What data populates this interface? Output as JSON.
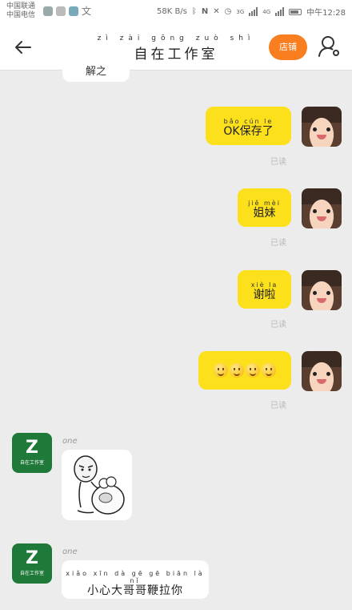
{
  "status_bar": {
    "carrier_line1": "中国联通",
    "carrier_line2": "中国电信",
    "net_speed": "58K B/s",
    "signal_3g": "3G",
    "signal_4g": "4G",
    "time": "中午12:28"
  },
  "header": {
    "title_pinyin": "zì zài gōng zuò shì",
    "title": "自在工作室",
    "store_button": "店铺"
  },
  "messages": {
    "cut_off_text": "解之",
    "msg1": {
      "pinyin": "bǎo cún le",
      "text": "OK保存了",
      "status": "已读"
    },
    "msg2": {
      "pinyin": "jiě mèi",
      "text": "姐妹",
      "status": "已读"
    },
    "msg3": {
      "pinyin": "xiè la",
      "text": "谢啦",
      "status": "已读"
    },
    "msg4": {
      "emoji": "smiley",
      "count": 4,
      "status": "已读"
    },
    "msg5": {
      "sender": "one",
      "avatar_letter": "Z",
      "avatar_caption": "自在工作室",
      "type": "sticker"
    },
    "msg6": {
      "sender": "one",
      "avatar_letter": "Z",
      "avatar_caption": "自在工作室",
      "pinyin": "xiǎo xīn dà gē gē biān là nǐ",
      "text": "小心大哥哥鞭拉你"
    }
  }
}
